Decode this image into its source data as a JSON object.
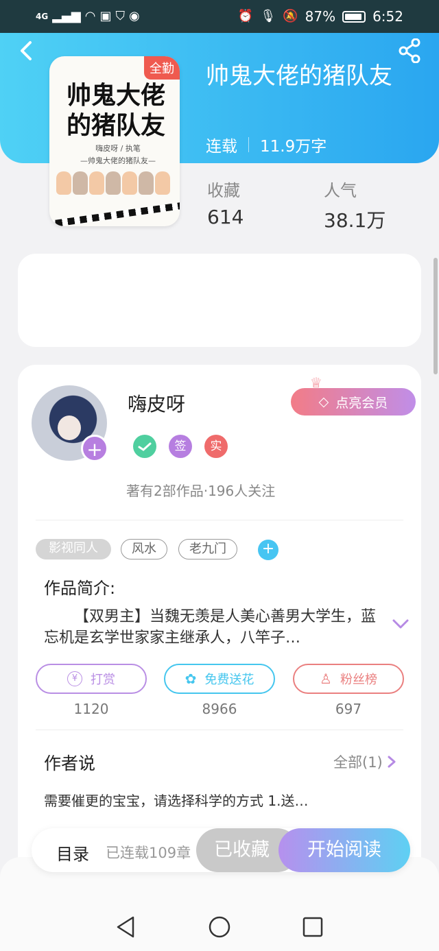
{
  "status_bar": {
    "network": "4G",
    "battery": "87%",
    "time": "6:52"
  },
  "book": {
    "title": "帅鬼大佬的猪队友",
    "status": "连载",
    "word_count": "11.9万字",
    "cover_badge": "全勤",
    "cover_title": "帅鬼大佬的猪队友",
    "cover_author": "嗨皮呀 / 执笔",
    "cover_subtitle": "—帅鬼大佬的猪队友—",
    "stats": {
      "favorites_label": "收藏",
      "favorites_value": "614",
      "popularity_label": "人气",
      "popularity_value": "38.1万"
    }
  },
  "author": {
    "name": "嗨皮呀",
    "badges": [
      "签",
      "实"
    ],
    "info": "著有2部作品·196人关注",
    "vip_button": "点亮会员"
  },
  "tags": [
    "影视同人",
    "风水",
    "老九门"
  ],
  "intro": {
    "title": "作品简介:",
    "text": "【双男主】当魏无羡是人美心善男大学生，蓝忘机是玄学世家家主继承人，八竿子…"
  },
  "actions": [
    {
      "label": "打赏",
      "count": "1120",
      "color": "#b98ee4"
    },
    {
      "label": "免费送花",
      "count": "8966",
      "color": "#45c6ee"
    },
    {
      "label": "粉丝榜",
      "count": "697",
      "color": "#ea7f7f"
    }
  ],
  "author_says": {
    "title": "作者说",
    "more": "全部(1)",
    "text": "需要催更的宝宝，请选择科学的方式 1.送…"
  },
  "bottom_bar": {
    "toc": "目录",
    "chapters": "已连载109章",
    "collected": "已收藏",
    "read": "开始阅读"
  }
}
